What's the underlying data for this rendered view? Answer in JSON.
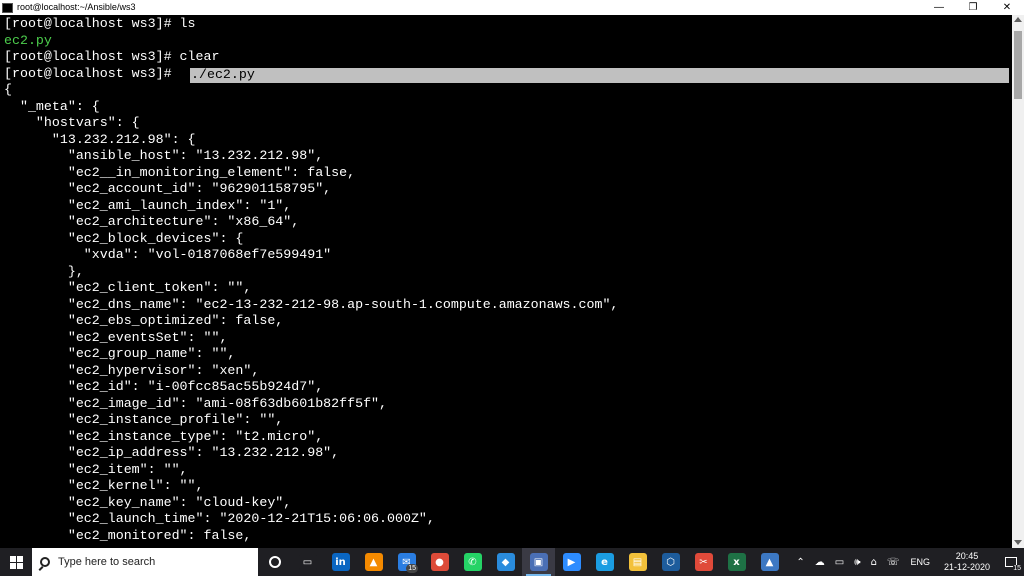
{
  "window": {
    "title": "root@localhost:~/Ansible/ws3",
    "controls": {
      "minimize": "—",
      "maximize": "❐",
      "close": "✕"
    }
  },
  "terminal": {
    "lines": [
      "[root@localhost ws3]# ls",
      "ec2.py",
      "[root@localhost ws3]# clear",
      "[root@localhost ws3]# ",
      "{",
      "  \"_meta\": {",
      "    \"hostvars\": {",
      "      \"13.232.212.98\": {",
      "        \"ansible_host\": \"13.232.212.98\",",
      "        \"ec2__in_monitoring_element\": false,",
      "        \"ec2_account_id\": \"962901158795\",",
      "        \"ec2_ami_launch_index\": \"1\",",
      "        \"ec2_architecture\": \"x86_64\",",
      "        \"ec2_block_devices\": {",
      "          \"xvda\": \"vol-0187068ef7e599491\"",
      "        },",
      "        \"ec2_client_token\": \"\",",
      "        \"ec2_dns_name\": \"ec2-13-232-212-98.ap-south-1.compute.amazonaws.com\",",
      "        \"ec2_ebs_optimized\": false,",
      "        \"ec2_eventsSet\": \"\",",
      "        \"ec2_group_name\": \"\",",
      "        \"ec2_hypervisor\": \"xen\",",
      "        \"ec2_id\": \"i-00fcc85ac55b924d7\",",
      "        \"ec2_image_id\": \"ami-08f63db601b82ff5f\",",
      "        \"ec2_instance_profile\": \"\",",
      "        \"ec2_instance_type\": \"t2.micro\",",
      "        \"ec2_ip_address\": \"13.232.212.98\",",
      "        \"ec2_item\": \"\",",
      "        \"ec2_kernel\": \"\",",
      "        \"ec2_key_name\": \"cloud-key\",",
      "        \"ec2_launch_time\": \"2020-12-21T15:06:06.000Z\",",
      "        \"ec2_monitored\": false,"
    ],
    "selected_command": "./ec2.py",
    "colors": {
      "background": "#000000",
      "text": "#ffffff",
      "filename": "#4ccc4c",
      "selection": "#c0c0c0"
    }
  },
  "taskbar": {
    "search_placeholder": "Type here to search",
    "apps": [
      {
        "name": "task-view-icon",
        "glyph": "▭",
        "color": "#1f1f23"
      },
      {
        "name": "linkedin-icon",
        "glyph": "in",
        "color": "#0a66c2"
      },
      {
        "name": "vlc-icon",
        "glyph": "▲",
        "color": "#f48a00"
      },
      {
        "name": "outlook-icon",
        "glyph": "✉",
        "color": "#2a7de1",
        "badge": "15"
      },
      {
        "name": "chrome-icon",
        "glyph": "●",
        "color": "#dd4b39"
      },
      {
        "name": "whatsapp-icon",
        "glyph": "✆",
        "color": "#25d366"
      },
      {
        "name": "vscode-icon",
        "glyph": "◆",
        "color": "#2a8cdd"
      },
      {
        "name": "network-app-icon",
        "glyph": "▣",
        "color": "#4a6fb5"
      },
      {
        "name": "zoom-icon",
        "glyph": "▶",
        "color": "#2d8cff"
      },
      {
        "name": "edge-icon",
        "glyph": "e",
        "color": "#1b9de2"
      },
      {
        "name": "file-explorer-icon",
        "glyph": "▤",
        "color": "#f3c13a"
      },
      {
        "name": "virtualbox-icon",
        "glyph": "⬡",
        "color": "#1d5c9c"
      },
      {
        "name": "snipping-tool-icon",
        "glyph": "✂",
        "color": "#e04a3a"
      },
      {
        "name": "excel-icon",
        "glyph": "x",
        "color": "#1e7145"
      },
      {
        "name": "photos-icon",
        "glyph": "▲",
        "color": "#3c78c3"
      }
    ],
    "tray": {
      "chevron": "⌃",
      "icons": [
        "☁",
        "▭",
        "🕪",
        "⌂",
        "☏"
      ],
      "language": "ENG",
      "time": "20:45",
      "date": "21-12-2020",
      "notification_count": "15"
    }
  }
}
